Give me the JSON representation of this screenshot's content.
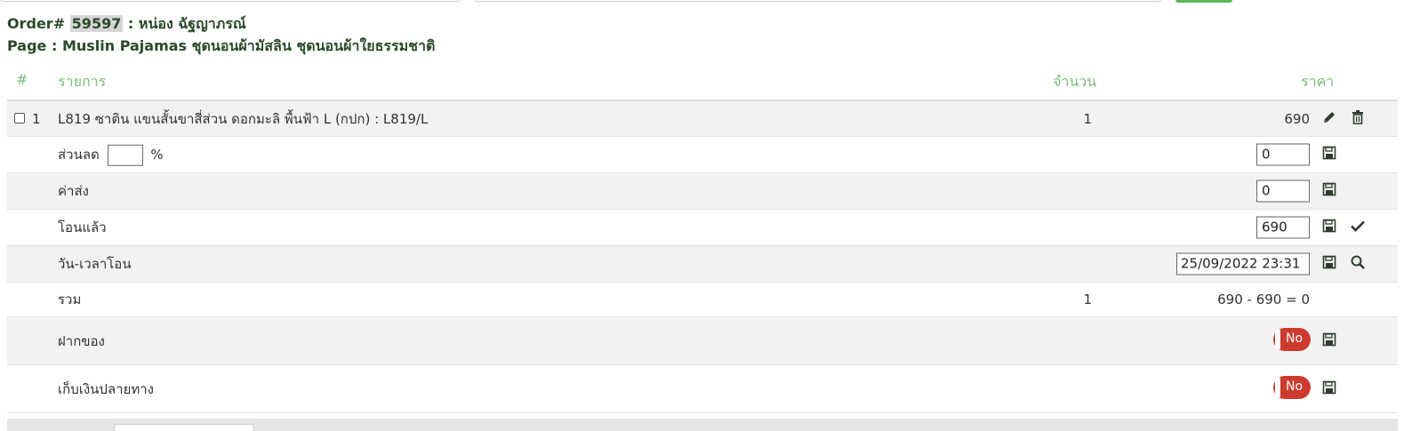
{
  "header": {
    "order_prefix": "Order#",
    "order_number": "59597",
    "customer": ": หน่อง ฉัฐญาภรณ์",
    "page_line": "Page : Muslin Pajamas ชุดนอนผ้ามัสลิน ชุดนอนผ้าใยธรรมชาติ"
  },
  "columns": {
    "index": "#",
    "item": "รายการ",
    "qty": "จำนวน",
    "price": "ราคา"
  },
  "item": {
    "index": "1",
    "name": "L819 ซาติน แขนสั้นขาสี่ส่วน ดอกมะลิ พื้นฟ้า L (กปก) : L819/L",
    "qty": "1",
    "price": "690"
  },
  "discount": {
    "label": "ส่วนลด",
    "unit": "%",
    "percent_value": "",
    "amount_value": "0"
  },
  "shipping": {
    "label": "ค่าส่ง",
    "value": "0"
  },
  "transferred": {
    "label": "โอนแล้ว",
    "value": "690"
  },
  "transfer_time": {
    "label": "วัน-เวลาโอน",
    "value": "25/09/2022 23:31"
  },
  "total": {
    "label": "รวม",
    "qty": "1",
    "formula": "690 - 690 = 0"
  },
  "deposit": {
    "label": "ฝากของ",
    "toggle": "No"
  },
  "cod": {
    "label": "เก็บเงินปลายทาง",
    "toggle": "No"
  },
  "colors": {
    "accent_green": "#7bbf7b",
    "toggle_red": "#cc3a2e",
    "icon_dark": "#2f3b2f"
  }
}
